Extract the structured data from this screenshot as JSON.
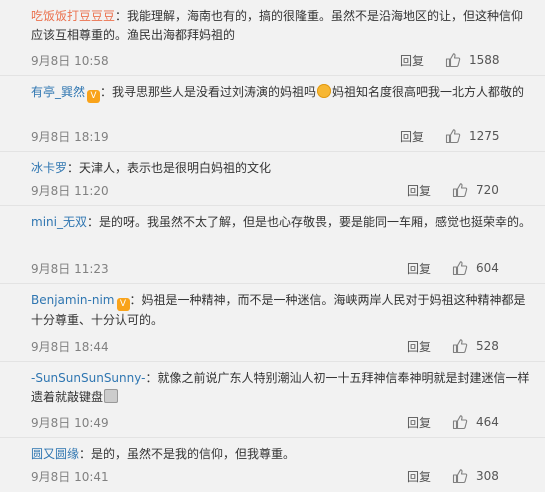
{
  "reply_label": "回复",
  "comments": [
    {
      "user": "吃饭饭打豆豆豆",
      "sep": "：",
      "text": "我能理解，海南也有的，搞的很隆重。虽然不是沿海地区的让，但这种信仰应该互相尊重的。渔民出海都拜妈祖的",
      "time": "9月8日 10:58",
      "likes": "1588"
    },
    {
      "user": "有亭_巽然",
      "sep": "：",
      "text_a": "我寻思那些人是没看过刘涛演的妈祖吗",
      "text_b": "妈祖知名度很高吧我一北方人都敬的",
      "time": "9月8日 18:19",
      "likes": "1275"
    },
    {
      "user": "冰卡罗",
      "sep": "：",
      "text": "天津人，表示也是很明白妈祖的文化",
      "time": "9月8日 11:20",
      "likes": "720"
    },
    {
      "user": "mini_无双",
      "sep": "：",
      "text": "是的呀。我虽然不太了解，但是也心存敬畏，要是能同一车厢，感觉也挺荣幸的。",
      "time": "9月8日 11:23",
      "likes": "604"
    },
    {
      "user": "Benjamin-nim",
      "sep": "：",
      "text": "妈祖是一种精神，而不是一种迷信。海峡两岸人民对于妈祖这种精神都是十分尊重、十分认可的。",
      "time": "9月8日 18:44",
      "likes": "528"
    },
    {
      "user": "-SunSunSunSunny-",
      "sep": "：",
      "text": "就像之前说广东人特别潮汕人初一十五拜神信奉神明就是封建迷信一样遗着就敲键盘",
      "time": "9月8日 10:49",
      "likes": "464"
    },
    {
      "user": "圆又圆缘",
      "sep": "：",
      "text": "是的，虽然不是我的信仰，但我尊重。",
      "time": "9月8日 10:41",
      "likes": "308"
    }
  ]
}
